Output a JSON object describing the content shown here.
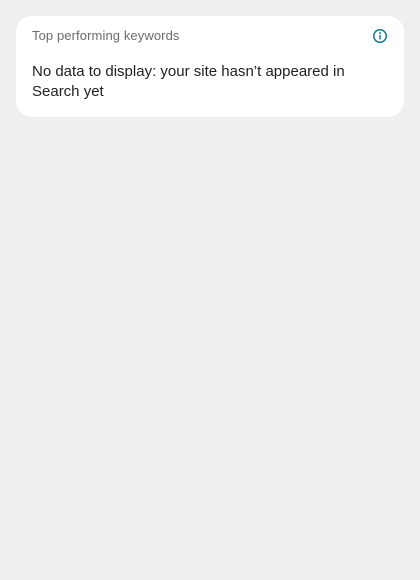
{
  "card": {
    "title": "Top performing keywords",
    "info_icon": "info-icon",
    "message": "No data to display: your site hasn’t appeared in Search yet"
  },
  "colors": {
    "page_background": "#efefef",
    "card_background": "#ffffff",
    "accent": "#137a8f",
    "title_text": "#6a6a6a",
    "body_text": "#1f1f1f"
  }
}
